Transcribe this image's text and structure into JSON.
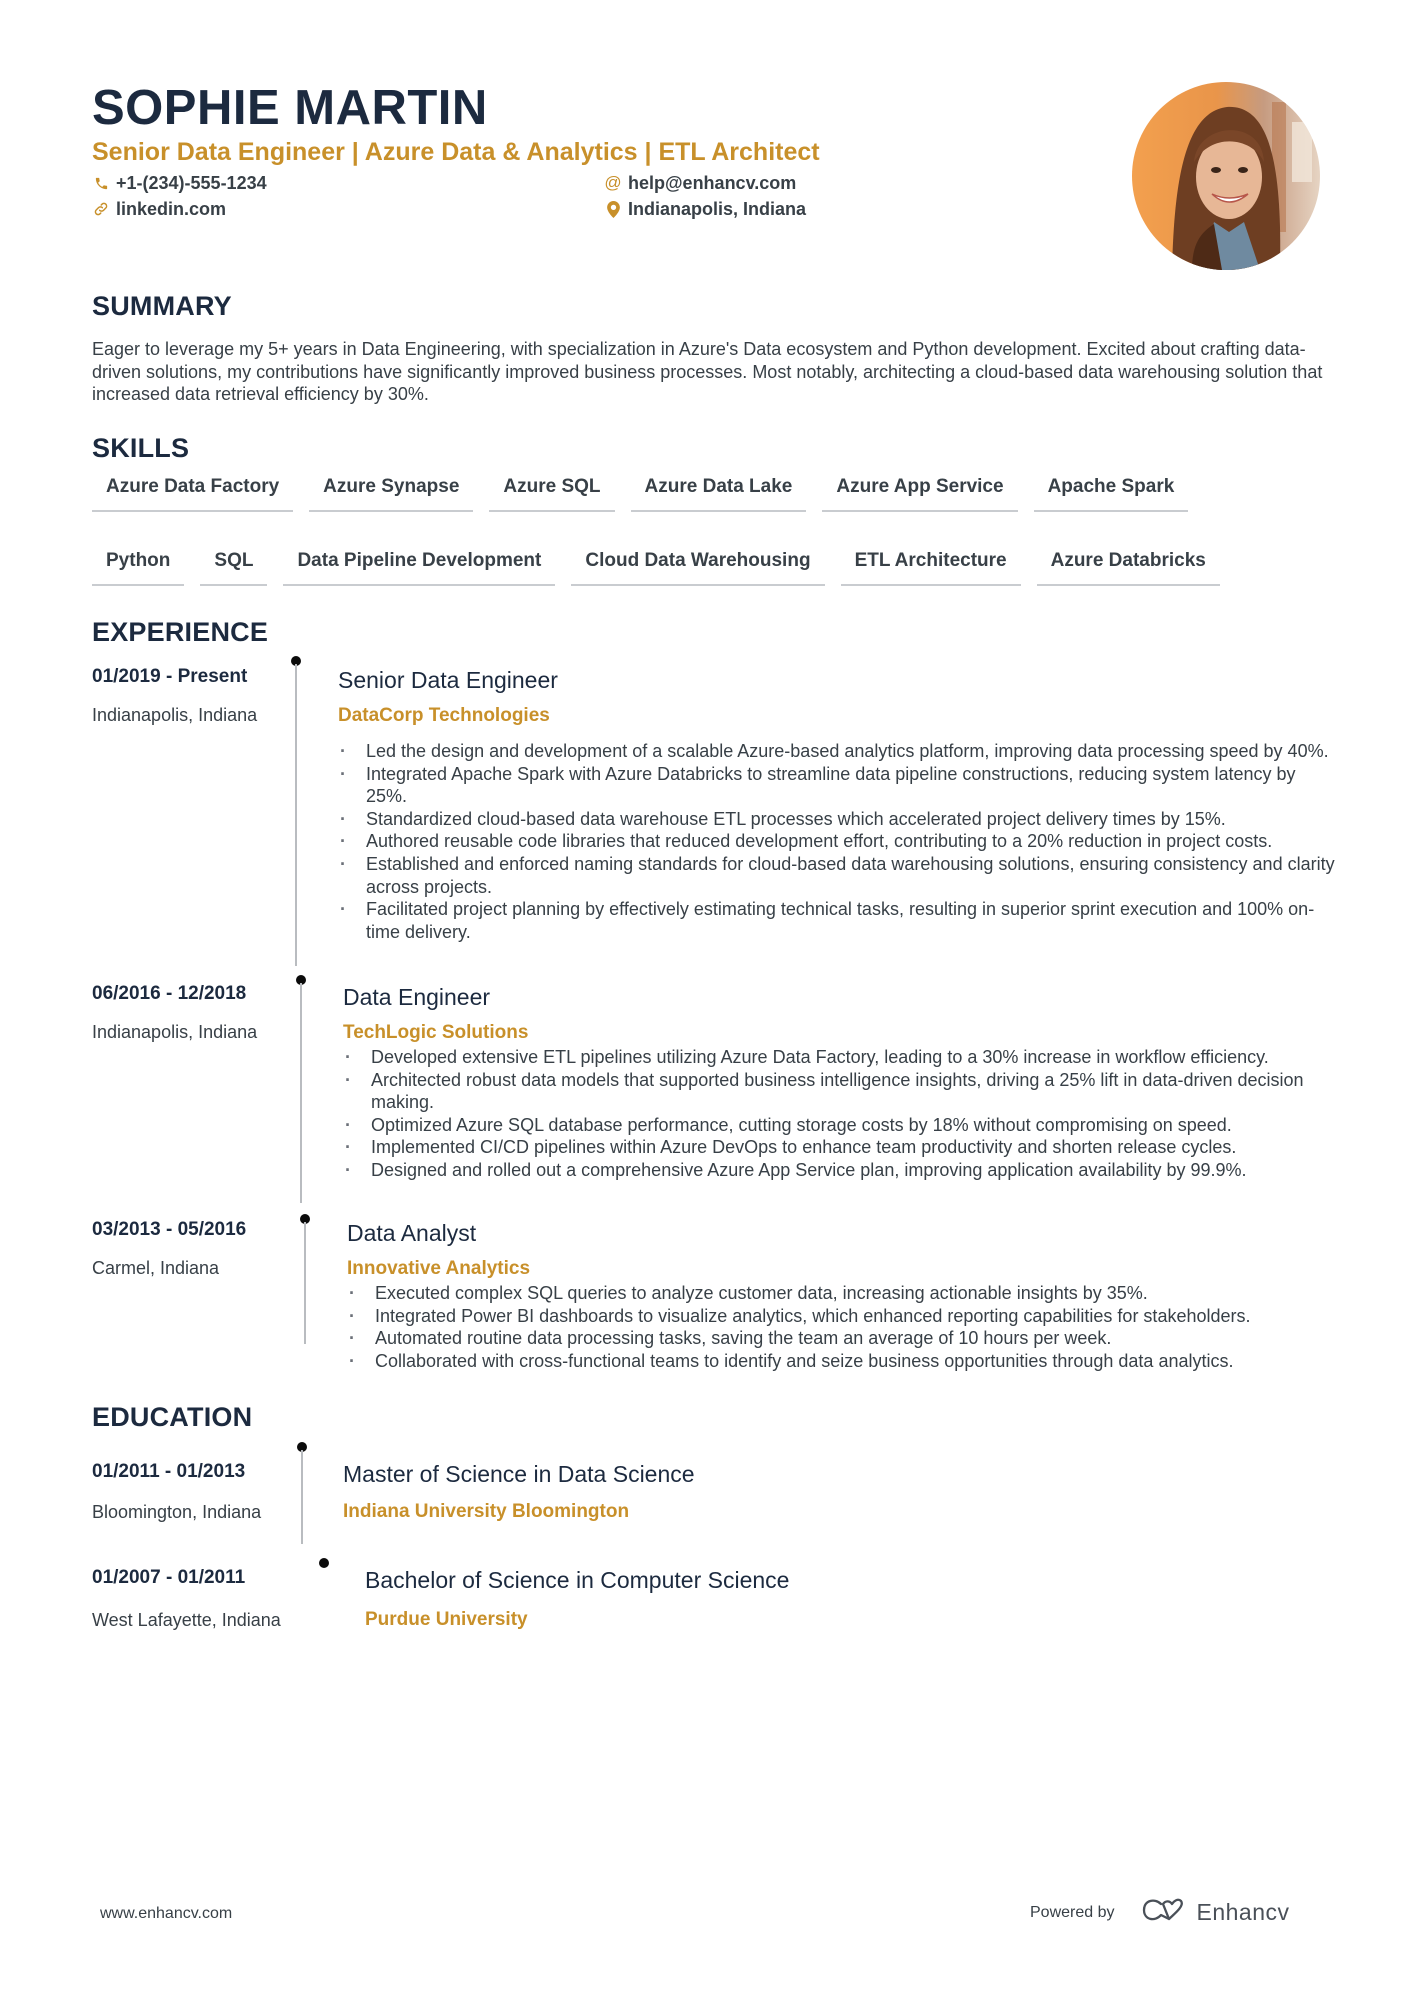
{
  "header": {
    "name": "SOPHIE MARTIN",
    "headline": "Senior Data Engineer | Azure Data & Analytics | ETL Architect",
    "contacts": {
      "phone": {
        "icon": "phone-icon",
        "text": "+1-(234)-555-1234"
      },
      "email": {
        "icon": "at-icon",
        "text": "help@enhancv.com"
      },
      "link": {
        "icon": "link-icon",
        "text": "linkedin.com"
      },
      "location": {
        "icon": "map-pin-icon",
        "text": "Indianapolis, Indiana"
      }
    },
    "photo_alt": "Profile photo of Sophie Martin"
  },
  "summary": {
    "title": "SUMMARY",
    "text": "Eager to leverage my 5+ years in Data Engineering, with specialization in Azure's Data ecosystem and Python development. Excited about crafting data-driven solutions, my contributions have significantly improved business processes. Most notably, architecting a cloud-based data warehousing solution that increased data retrieval efficiency by 30%."
  },
  "skills": {
    "title": "SKILLS",
    "items": [
      "Azure Data Factory",
      "Azure Synapse",
      "Azure SQL",
      "Azure Data Lake",
      "Azure App Service",
      "Apache Spark",
      "Python",
      "SQL",
      "Data Pipeline Development",
      "Cloud Data Warehousing",
      "ETL Architecture",
      "Azure Databricks"
    ]
  },
  "experience": {
    "title": "EXPERIENCE",
    "jobs": [
      {
        "dates": "01/2019 - Present",
        "location": "Indianapolis, Indiana",
        "role": "Senior Data Engineer",
        "company": "DataCorp Technologies",
        "bullets": [
          "Led the design and development of a scalable Azure-based analytics platform, improving data processing speed by 40%.",
          "Integrated Apache Spark with Azure Databricks to streamline data pipeline constructions, reducing system latency by 25%.",
          "Standardized cloud-based data warehouse ETL processes which accelerated project delivery times by 15%.",
          "Authored reusable code libraries that reduced development effort, contributing to a 20% reduction in project costs.",
          "Established and enforced naming standards for cloud-based data warehousing solutions, ensuring consistency and clarity across projects.",
          "Facilitated project planning by effectively estimating technical tasks, resulting in superior sprint execution and 100% on-time delivery."
        ]
      },
      {
        "dates": "06/2016 - 12/2018",
        "location": "Indianapolis, Indiana",
        "role": "Data Engineer",
        "company": "TechLogic Solutions",
        "bullets": [
          "Developed extensive ETL pipelines utilizing Azure Data Factory, leading to a 30% increase in workflow efficiency.",
          "Architected robust data models that supported business intelligence insights, driving a 25% lift in data-driven decision making.",
          "Optimized Azure SQL database performance, cutting storage costs by 18% without compromising on speed.",
          "Implemented CI/CD pipelines within Azure DevOps to enhance team productivity and shorten release cycles.",
          "Designed and rolled out a comprehensive Azure App Service plan, improving application availability by 99.9%."
        ]
      },
      {
        "dates": "03/2013 - 05/2016",
        "location": "Carmel, Indiana",
        "role": "Data Analyst",
        "company": "Innovative Analytics",
        "bullets": [
          "Executed complex SQL queries to analyze customer data, increasing actionable insights by 35%.",
          "Integrated Power BI dashboards to visualize analytics, which enhanced reporting capabilities for stakeholders.",
          "Automated routine data processing tasks, saving the team an average of 10 hours per week.",
          "Collaborated with cross-functional teams to identify and seize business opportunities through data analytics."
        ]
      }
    ]
  },
  "education": {
    "title": "EDUCATION",
    "items": [
      {
        "dates": "01/2011 - 01/2013",
        "location": "Bloomington, Indiana",
        "degree": "Master of Science in Data Science",
        "school": "Indiana University Bloomington"
      },
      {
        "dates": "01/2007 - 01/2011",
        "location": "West Lafayette, Indiana",
        "degree": "Bachelor of Science in Computer Science",
        "school": "Purdue University"
      }
    ]
  },
  "footer": {
    "website": "www.enhancv.com",
    "powered_by": "Powered by",
    "brand": "Enhancv",
    "brand_icon": "enhancv-logo-icon"
  },
  "colors": {
    "accent": "#c8902a",
    "heading": "#1c2a3f",
    "text": "#384047"
  }
}
